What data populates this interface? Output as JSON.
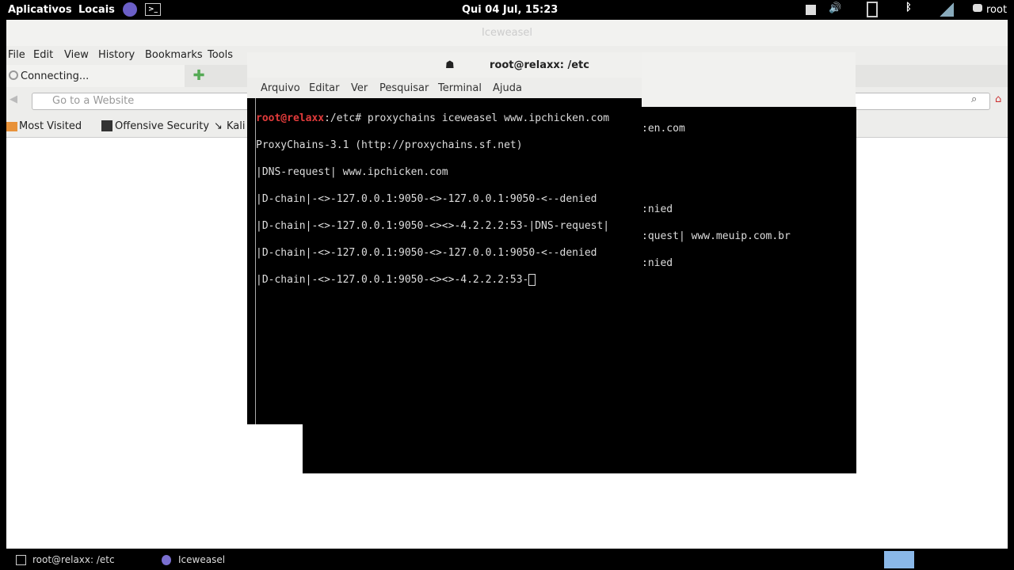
{
  "top_panel": {
    "apps": "Aplicativos",
    "places": "Locais",
    "clock": "Qui 04 Jul, 15:23",
    "user": "root",
    "icons": [
      "stop-icon",
      "volume-icon",
      "battery-icon",
      "bluetooth-icon",
      "signal-icon",
      "chat-icon"
    ]
  },
  "browser": {
    "title": "Iceweasel",
    "menu": [
      "File",
      "Edit",
      "View",
      "History",
      "Bookmarks",
      "Tools"
    ],
    "tab_label": "Connecting...",
    "url_placeholder": "Go to a Website",
    "bookmarks": [
      "Most Visited",
      "Offensive Security",
      "Kali"
    ]
  },
  "terminal": {
    "title": "root@relaxx: /etc",
    "menu": [
      "Arquivo",
      "Editar",
      "Ver",
      "Pesquisar",
      "Terminal",
      "Ajuda"
    ],
    "prompt_user": "root@relaxx",
    "prompt_path": ":/etc# ",
    "command": "proxychains iceweasel www.ipchicken.com",
    "lines": [
      "ProxyChains-3.1 (http://proxychains.sf.net)",
      "|DNS-request| www.ipchicken.com",
      "|D-chain|-<>-127.0.0.1:9050-<>-127.0.0.1:9050-<--denied",
      "|D-chain|-<>-127.0.0.1:9050-<><>-4.2.2.2:53-|DNS-request|",
      "|D-chain|-<>-127.0.0.1:9050-<>-127.0.0.1:9050-<--denied",
      "|D-chain|-<>-127.0.0.1:9050-<><>-4.2.2.2:53-"
    ],
    "ghost_lines": [
      ":en.com",
      "",
      "",
      ":nied",
      ":quest| www.meuip.com.br",
      ":nied"
    ]
  },
  "taskbar": {
    "items": [
      "root@relaxx: /etc",
      "Iceweasel"
    ]
  }
}
